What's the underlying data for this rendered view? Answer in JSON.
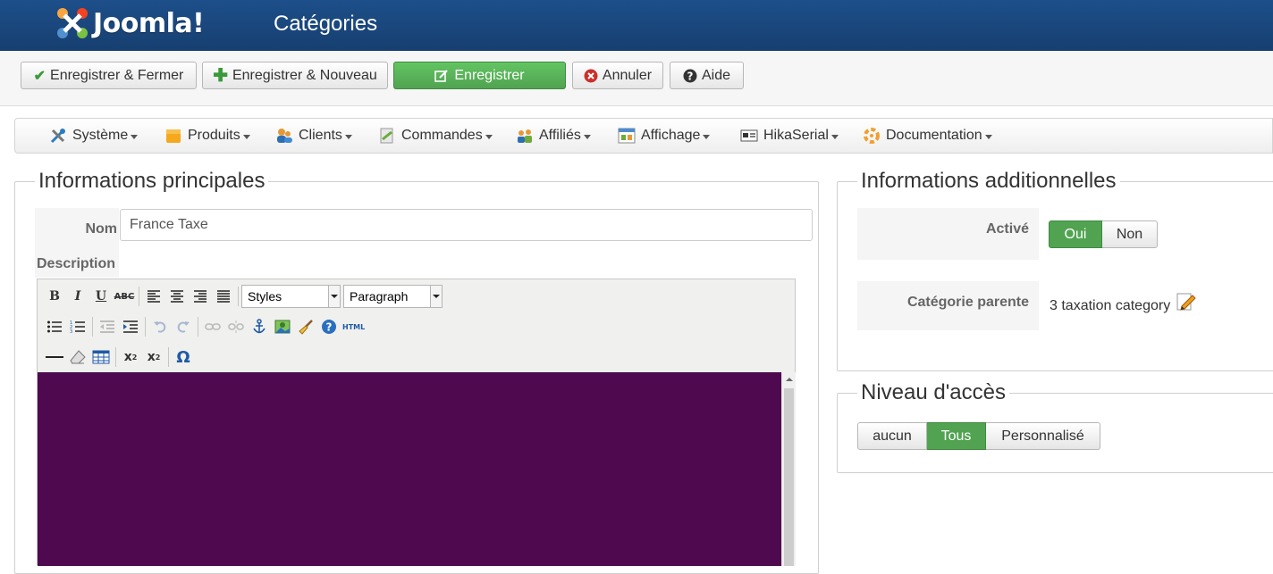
{
  "app": {
    "brand": "Joomla!",
    "page_title": "Catégories"
  },
  "toolbar": {
    "save_close": "Enregistrer & Fermer",
    "save_new": "Enregistrer & Nouveau",
    "save": "Enregistrer",
    "cancel": "Annuler",
    "help": "Aide"
  },
  "menu": {
    "items": [
      {
        "label": "Système",
        "icon": "tools-icon"
      },
      {
        "label": "Produits",
        "icon": "products-icon"
      },
      {
        "label": "Clients",
        "icon": "customers-icon"
      },
      {
        "label": "Commandes",
        "icon": "orders-icon"
      },
      {
        "label": "Affiliés",
        "icon": "affiliates-icon"
      },
      {
        "label": "Affichage",
        "icon": "display-icon"
      },
      {
        "label": "HikaSerial",
        "icon": "serial-icon"
      },
      {
        "label": "Documentation",
        "icon": "documentation-icon"
      }
    ]
  },
  "main_info": {
    "legend": "Informations principales",
    "name_label": "Nom",
    "name_value": "France Taxe",
    "description_label": "Description",
    "editor": {
      "styles_select": "Styles",
      "format_select": "Paragraph",
      "bg_color": "#4f0a4f"
    }
  },
  "additional_info": {
    "legend": "Informations additionnelles",
    "enabled_label": "Activé",
    "enabled_options": [
      "Oui",
      "Non"
    ],
    "enabled_selected": "Oui",
    "parent_label": "Catégorie parente",
    "parent_value": "3 taxation category"
  },
  "access": {
    "legend": "Niveau d'accès",
    "options": [
      "aucun",
      "Tous",
      "Personnalisé"
    ],
    "selected": "Tous"
  },
  "colors": {
    "header": "#1d4f8a",
    "success": "#51a351"
  }
}
